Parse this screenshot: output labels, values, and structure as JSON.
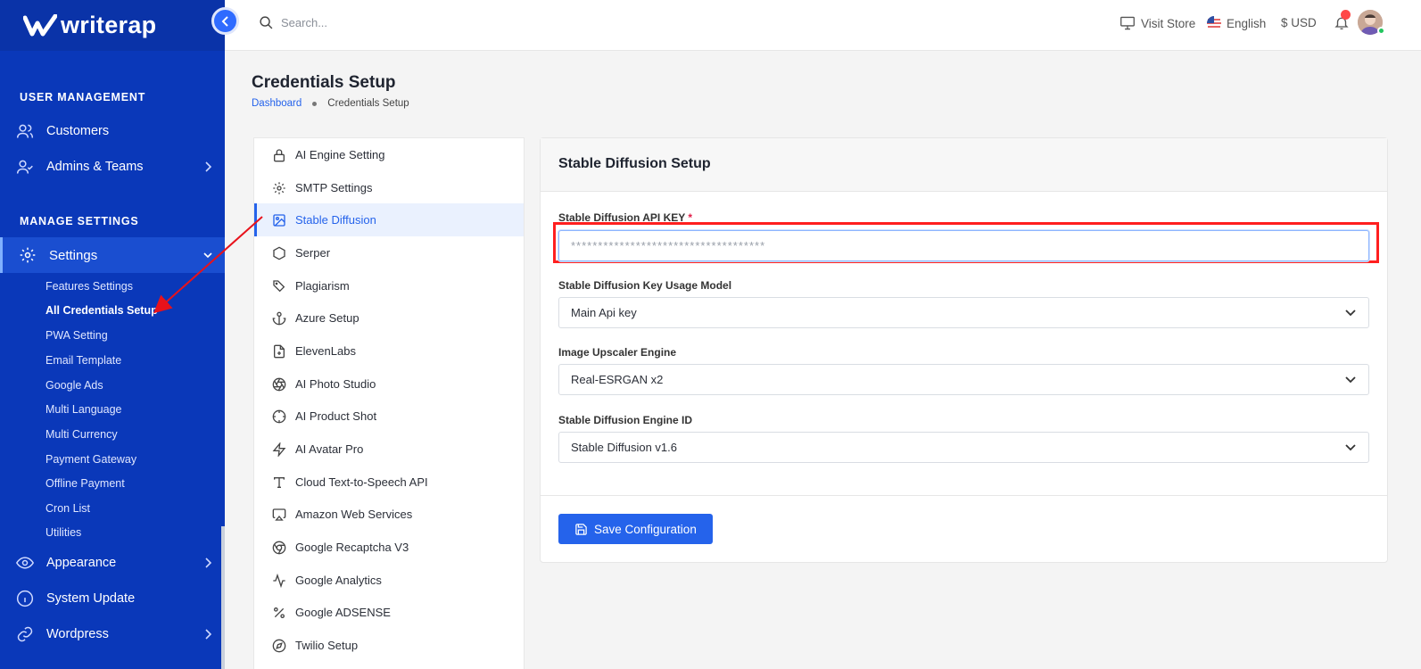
{
  "app": {
    "logo_text": "writerap"
  },
  "search": {
    "placeholder": "Search..."
  },
  "topbar": {
    "visit_store": "Visit Store",
    "language": "English",
    "currency": "$ USD"
  },
  "sidebar": {
    "sections": [
      {
        "title": "USER MANAGEMENT"
      },
      {
        "title": "MANAGE SETTINGS"
      }
    ],
    "items": [
      {
        "label": "Customers",
        "icon": "users-icon"
      },
      {
        "label": "Admins & Teams",
        "icon": "user-check-icon"
      },
      {
        "label": "Settings",
        "icon": "gear-icon"
      },
      {
        "label": "Appearance",
        "icon": "eye-icon"
      },
      {
        "label": "System Update",
        "icon": "info-icon"
      },
      {
        "label": "Wordpress",
        "icon": "link-icon"
      }
    ],
    "sub_items": [
      "Features Settings",
      "All Credentials Setup",
      "PWA Setting",
      "Email Template",
      "Google Ads",
      "Multi Language",
      "Multi Currency",
      "Payment Gateway",
      "Offline Payment",
      "Cron List",
      "Utilities"
    ],
    "active_sub": "All Credentials Setup"
  },
  "page": {
    "title": "Credentials Setup",
    "breadcrumb": {
      "home": "Dashboard",
      "current": "Credentials Setup"
    }
  },
  "settings_list": [
    {
      "label": "AI Engine Setting",
      "icon": "lock-icon"
    },
    {
      "label": "SMTP Settings",
      "icon": "gear-icon"
    },
    {
      "label": "Stable Diffusion",
      "icon": "image-icon"
    },
    {
      "label": "Serper",
      "icon": "hexagon-icon"
    },
    {
      "label": "Plagiarism",
      "icon": "tag-icon"
    },
    {
      "label": "Azure Setup",
      "icon": "anchor-icon"
    },
    {
      "label": "ElevenLabs",
      "icon": "file-plus-icon"
    },
    {
      "label": "AI Photo Studio",
      "icon": "aperture-icon"
    },
    {
      "label": "AI Product Shot",
      "icon": "crosshair-icon"
    },
    {
      "label": "AI Avatar Pro",
      "icon": "zap-icon"
    },
    {
      "label": "Cloud Text-to-Speech API",
      "icon": "type-icon"
    },
    {
      "label": "Amazon Web Services",
      "icon": "airplay-icon"
    },
    {
      "label": "Google Recaptcha V3",
      "icon": "chrome-icon"
    },
    {
      "label": "Google Analytics",
      "icon": "activity-icon"
    },
    {
      "label": "Google ADSENSE",
      "icon": "percent-icon"
    },
    {
      "label": "Twilio Setup",
      "icon": "compass-icon"
    }
  ],
  "settings_active": "Stable Diffusion",
  "form": {
    "title": "Stable Diffusion Setup",
    "api_key": {
      "label": "Stable Diffusion API KEY",
      "required_mark": "*",
      "value": "************************************"
    },
    "key_usage": {
      "label": "Stable Diffusion Key Usage Model",
      "value": "Main Api key"
    },
    "upscaler": {
      "label": "Image Upscaler Engine",
      "value": "Real-ESRGAN x2"
    },
    "engine_id": {
      "label": "Stable Diffusion Engine ID",
      "value": "Stable Diffusion v1.6"
    },
    "save_label": "Save Configuration"
  },
  "colors": {
    "sidebar_bg": "#0a38b9",
    "accent": "#2563eb",
    "highlight": "#ff1f1f"
  }
}
